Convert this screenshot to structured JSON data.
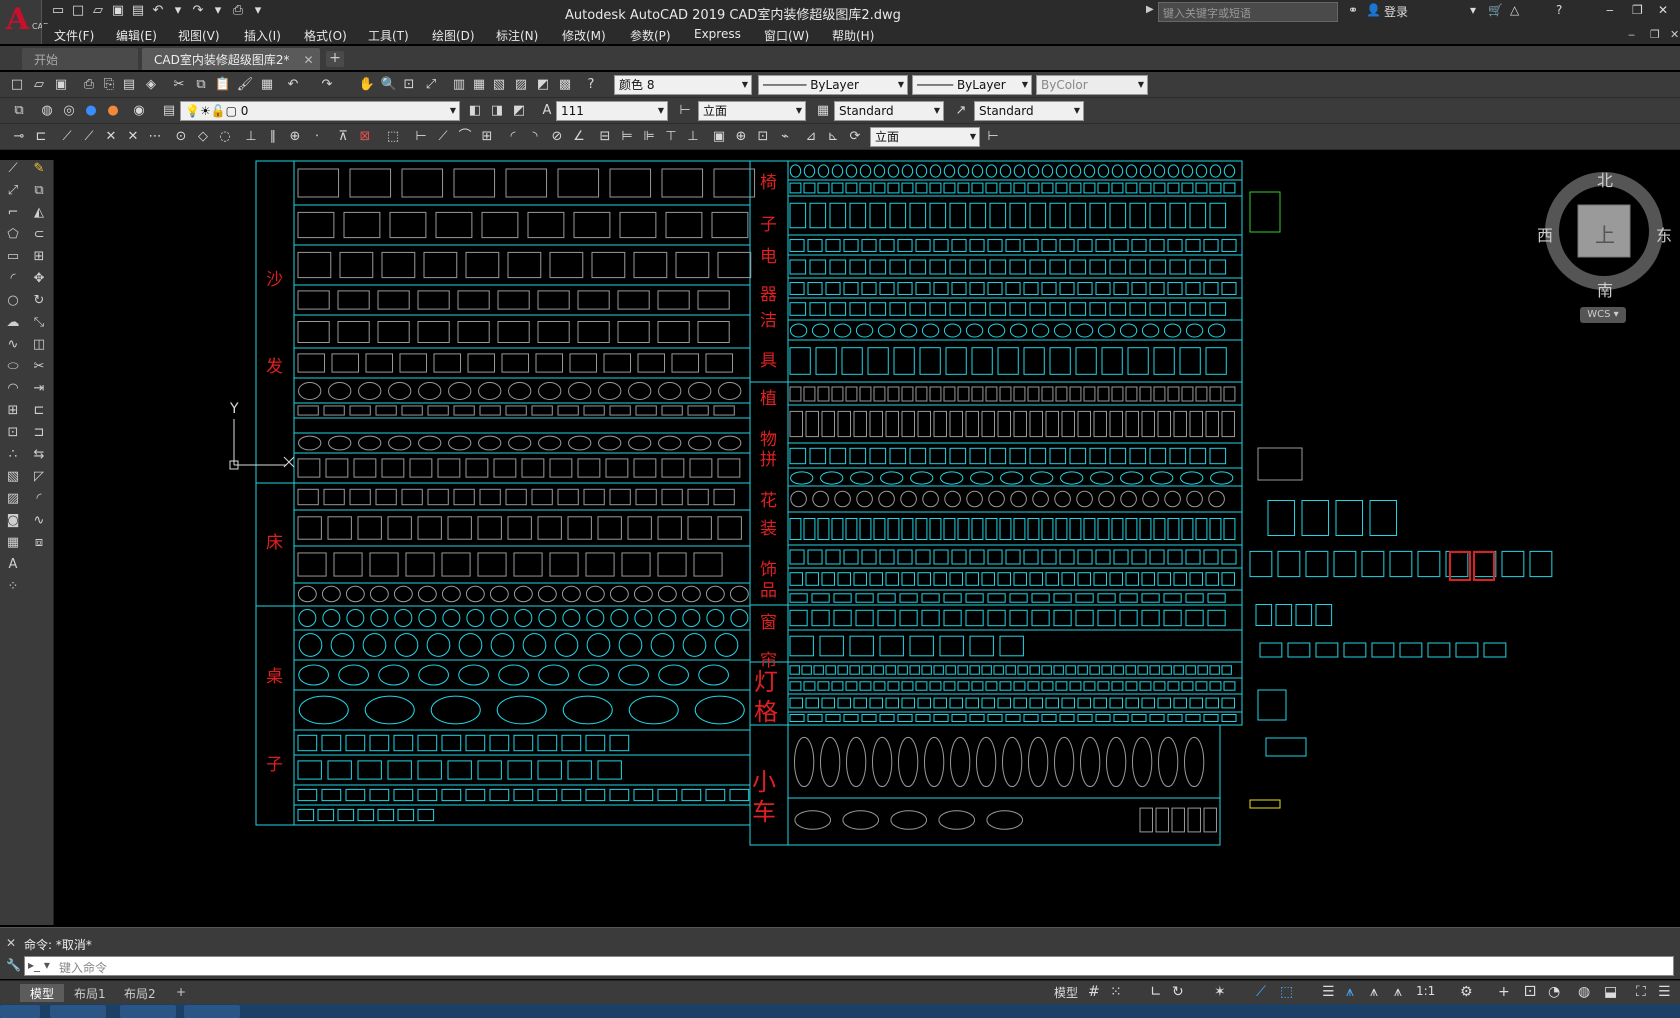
{
  "app": {
    "logo_letter": "A",
    "logo_caption": "CAD",
    "title": "Autodesk AutoCAD 2019    CAD室内装修超级图库2.dwg",
    "search_placeholder": "键入关键字或短语",
    "login": "登录"
  },
  "menu": [
    "文件(F)",
    "编辑(E)",
    "视图(V)",
    "插入(I)",
    "格式(O)",
    "工具(T)",
    "绘图(D)",
    "标注(N)",
    "修改(M)",
    "参数(P)",
    "Express",
    "窗口(W)",
    "帮助(H)"
  ],
  "tabs": [
    {
      "label": "开始",
      "active": false
    },
    {
      "label": "CAD室内装修超级图库2*",
      "active": true
    }
  ],
  "toolbar_standard": {
    "color_combo": "颜色 8",
    "linetype_combo": "ByLayer",
    "lineweight_combo": "ByLayer",
    "plotstyle_combo": "ByColor"
  },
  "toolbar_layers": {
    "layer_combo": "0",
    "text_style": "111",
    "dim_style": "立面",
    "table_style": "Standard",
    "multileader_style": "Standard"
  },
  "toolbar_dim": {
    "dim_style": "立面"
  },
  "viewcube": {
    "north": "北",
    "south": "南",
    "east": "东",
    "west": "西",
    "face": "上",
    "wcs": "WCS"
  },
  "ucs": {
    "x": "X",
    "y": "Y"
  },
  "drawing_labels": {
    "sofa_1": "沙",
    "sofa_2": "发",
    "bed": "床",
    "table_1": "桌",
    "table_2": "子",
    "chair_1": "椅",
    "chair_2": "子",
    "appliance_1": "电",
    "appliance_2": "器",
    "sanitary_1": "洁",
    "sanitary_2": "具",
    "plant_1": "植",
    "plant_2": "物",
    "parquet_1": "拼",
    "parquet_2": "花",
    "decor_1": "装",
    "decor_2": "饰",
    "decor_3": "品",
    "curtain_1": "窗",
    "curtain_2": "帘",
    "lamp": "灯",
    "grille": "格",
    "car_1": "小",
    "car_2": "车"
  },
  "command": {
    "history": "命令: *取消*",
    "placeholder": "键入命令"
  },
  "layouts": [
    {
      "label": "模型",
      "active": true
    },
    {
      "label": "布局1",
      "active": false
    },
    {
      "label": "布局2",
      "active": false
    }
  ],
  "status": {
    "model_label": "模型",
    "scale": "1:1"
  },
  "colors": {
    "grid_lines": "#1fd6e6",
    "labels": "#e02020",
    "block_gray": "#9a9a9a"
  }
}
